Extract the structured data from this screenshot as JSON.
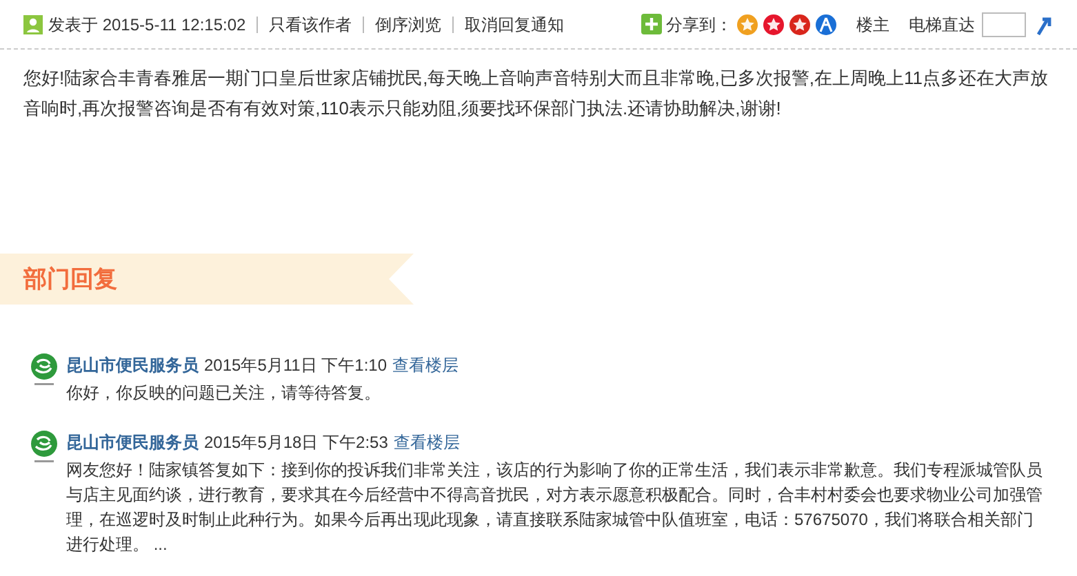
{
  "post_bar": {
    "posted": "发表于 2015-5-11 12:15:02",
    "links": [
      "只看该作者",
      "倒序浏览",
      "取消回复通知"
    ],
    "share_label": "分享到：",
    "floor": "楼主",
    "elevator_label": "电梯直达"
  },
  "post_body": "您好!陆家合丰青春雅居一期门口皇后世家店铺扰民,每天晚上音响声音特别大而且非常晚,已多次报警,在上周晚上11点多还在大声放音响时,再次报警咨询是否有有效对策,110表示只能劝阻,须要找环保部门执法.还请协助解决,谢谢!",
  "section_title": "部门回复",
  "replies": [
    {
      "author": "昆山市便民服务员",
      "date": "2015年5月11日 下午1:10",
      "link": "查看楼层",
      "text": "你好，你反映的问题已关注，请等待答复。"
    },
    {
      "author": "昆山市便民服务员",
      "date": "2015年5月18日 下午2:53",
      "link": "查看楼层",
      "text": "网友您好！陆家镇答复如下：接到你的投诉我们非常关注，该店的行为影响了你的正常生活，我们表示非常歉意。我们专程派城管队员与店主见面约谈，进行教育，要求其在今后经营中不得高音扰民，对方表示愿意积极配合。同时，合丰村村委会也要求物业公司加强管理，在巡逻时及时制止此种行为。如果今后再出现此现象，请直接联系陆家城管中队值班室，电话：57675070，我们将联合相关部门进行处理。 ..."
    }
  ]
}
